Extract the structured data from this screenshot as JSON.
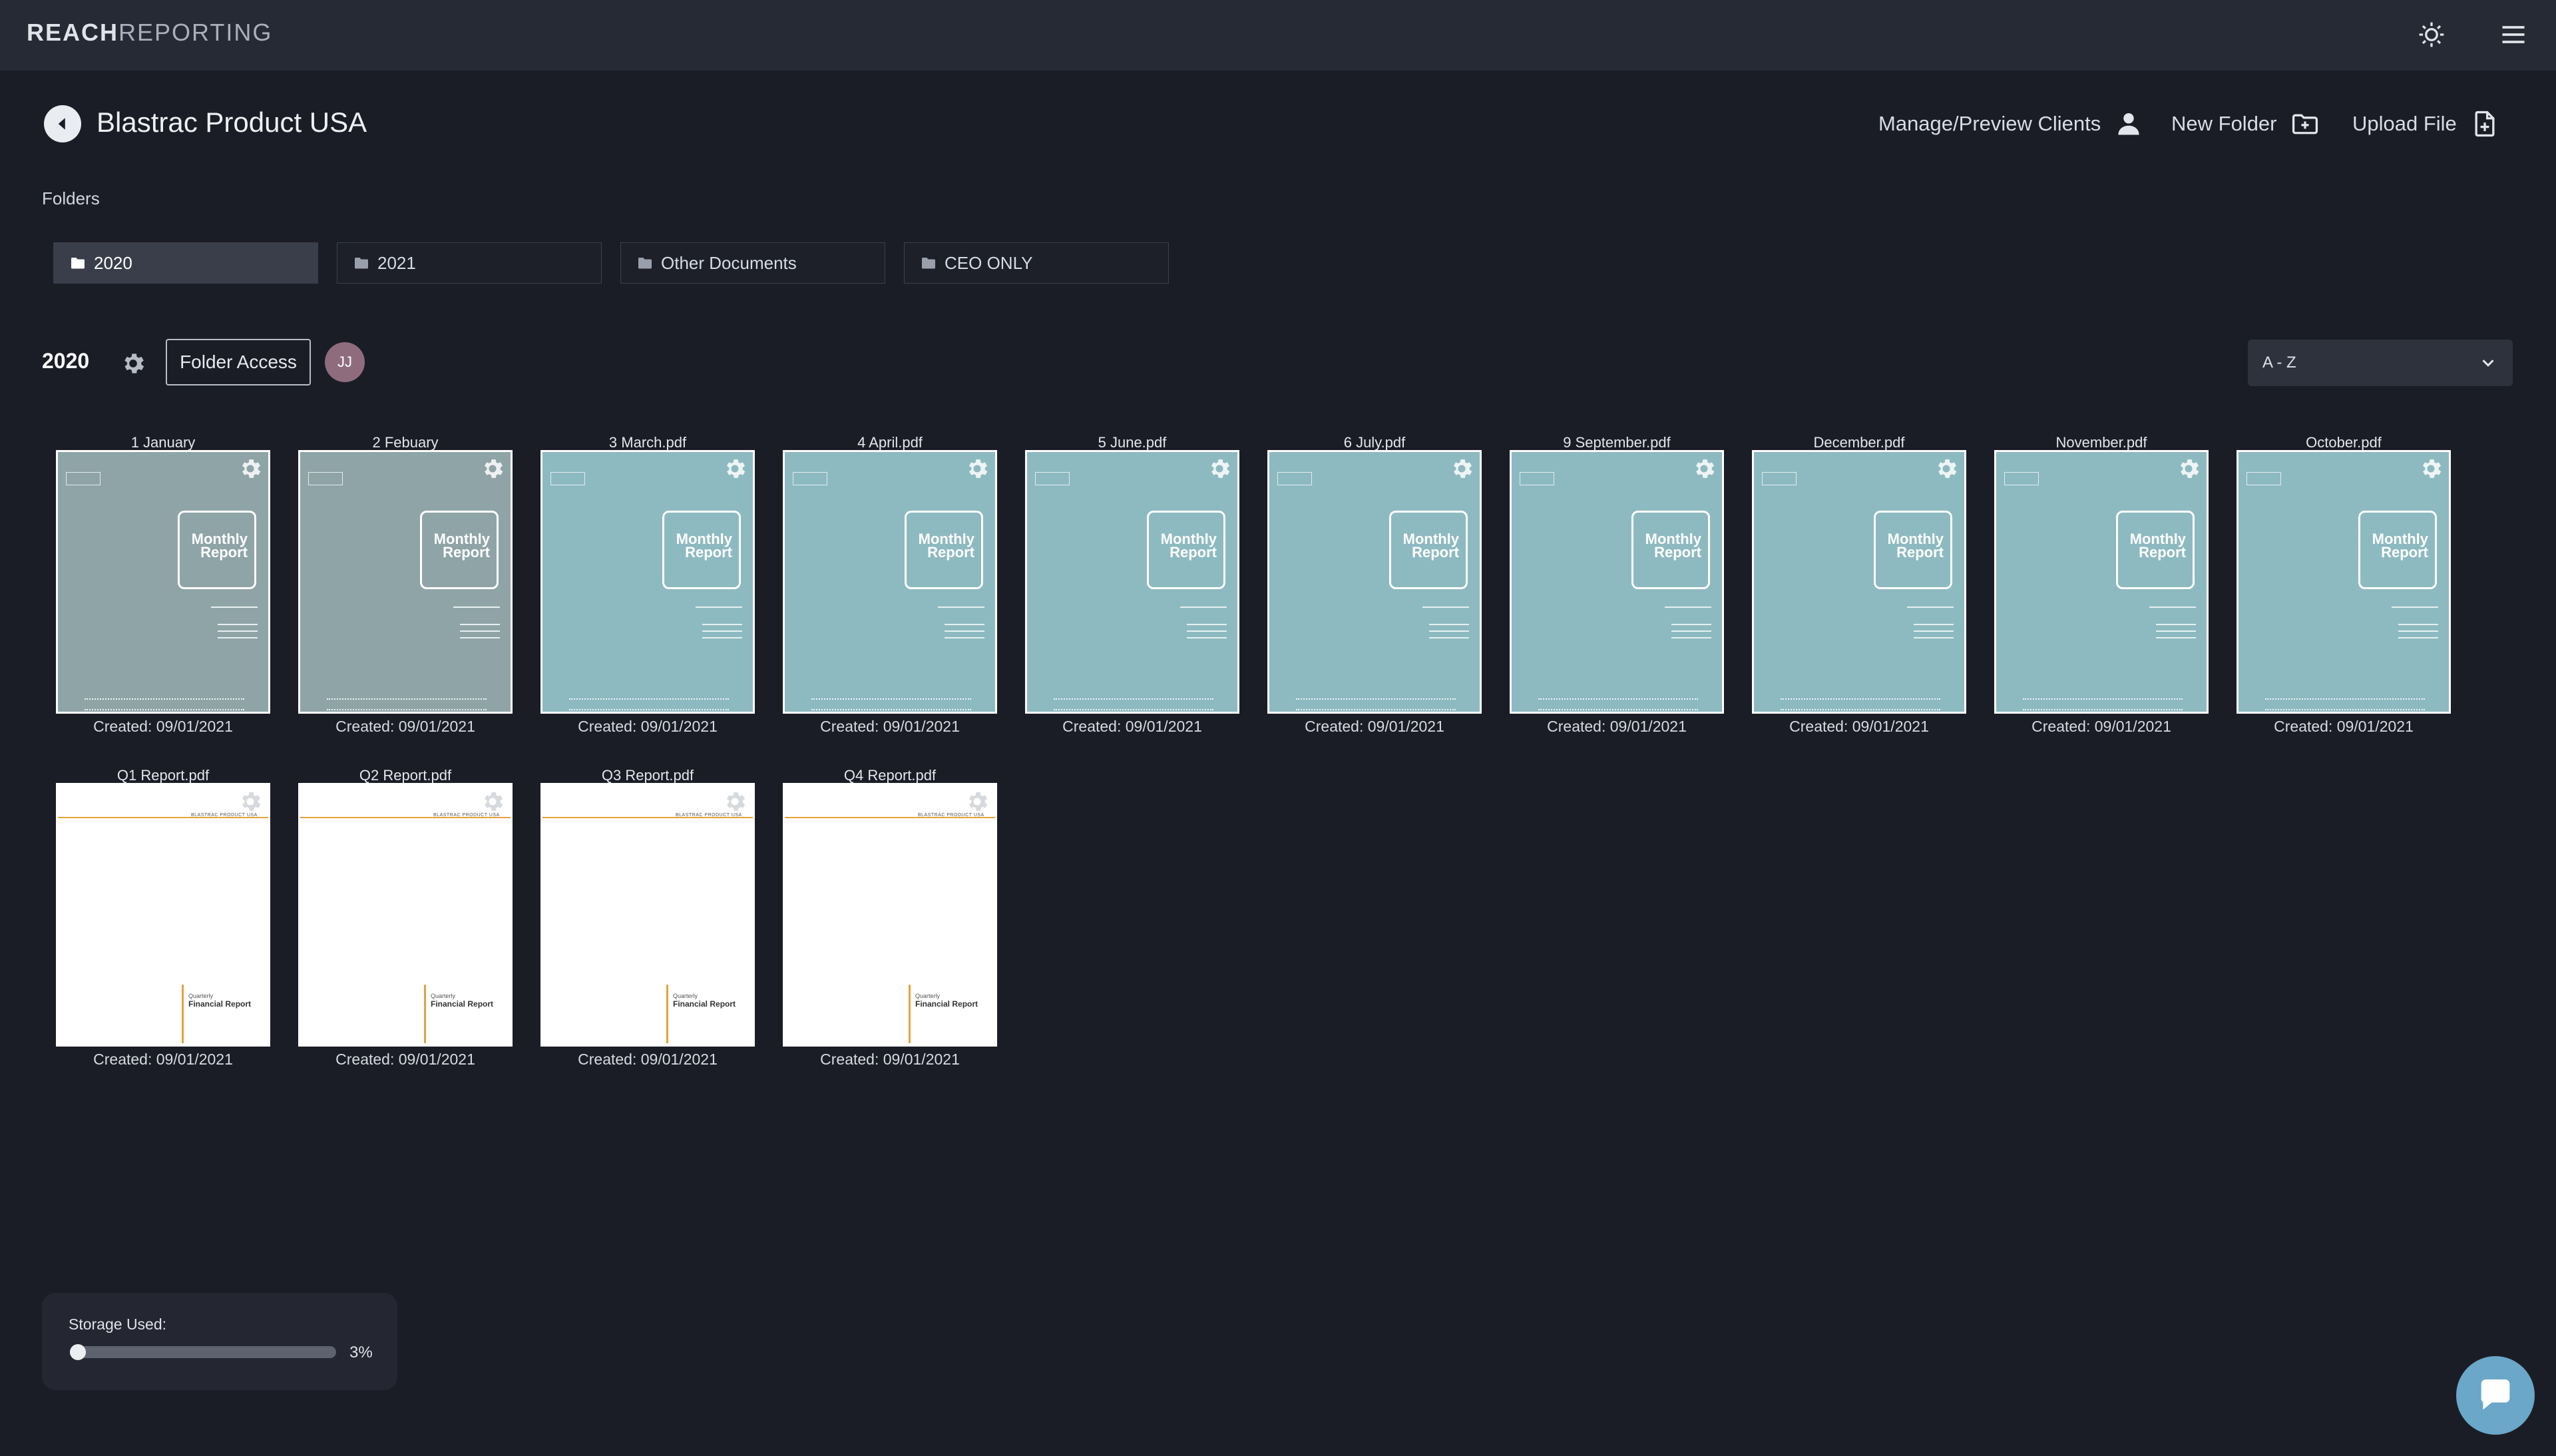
{
  "app": {
    "brand_bold": "REACH",
    "brand_light": "REPORTING"
  },
  "header": {
    "title": "Blastrac Product USA",
    "actions": [
      "Manage/Preview Clients",
      "New Folder",
      "Upload File"
    ]
  },
  "folders_label": "Folders",
  "folders": [
    "2020",
    "2021",
    "Other Documents",
    "CEO ONLY"
  ],
  "active_folder": {
    "name": "2020",
    "access_label": "Folder Access",
    "avatar_initials": "JJ"
  },
  "sort": {
    "value": "A - Z"
  },
  "files": [
    {
      "name": "1 January",
      "created": "Created: 09/01/2021",
      "kind": "monthly",
      "shade": "gray"
    },
    {
      "name": "2 Febuary",
      "created": "Created: 09/01/2021",
      "kind": "monthly",
      "shade": "gray"
    },
    {
      "name": "3 March.pdf",
      "created": "Created: 09/01/2021",
      "kind": "monthly",
      "shade": "teal"
    },
    {
      "name": "4 April.pdf",
      "created": "Created: 09/01/2021",
      "kind": "monthly",
      "shade": "teal"
    },
    {
      "name": "5 June.pdf",
      "created": "Created: 09/01/2021",
      "kind": "monthly",
      "shade": "teal"
    },
    {
      "name": "6 July.pdf",
      "created": "Created: 09/01/2021",
      "kind": "monthly",
      "shade": "teal"
    },
    {
      "name": "9 September.pdf",
      "created": "Created: 09/01/2021",
      "kind": "monthly",
      "shade": "teal"
    },
    {
      "name": "December.pdf",
      "created": "Created: 09/01/2021",
      "kind": "monthly",
      "shade": "teal"
    },
    {
      "name": "November.pdf",
      "created": "Created: 09/01/2021",
      "kind": "monthly",
      "shade": "teal"
    },
    {
      "name": "October.pdf",
      "created": "Created: 09/01/2021",
      "kind": "monthly",
      "shade": "teal"
    },
    {
      "name": "Q1 Report.pdf",
      "created": "Created: 09/01/2021",
      "kind": "quarterly"
    },
    {
      "name": "Q2 Report.pdf",
      "created": "Created: 09/01/2021",
      "kind": "quarterly"
    },
    {
      "name": "Q3 Report.pdf",
      "created": "Created: 09/01/2021",
      "kind": "quarterly"
    },
    {
      "name": "Q4 Report.pdf",
      "created": "Created: 09/01/2021",
      "kind": "quarterly"
    }
  ],
  "thumb_text": {
    "monthly_title_1": "Monthly",
    "monthly_title_2": "Report",
    "quarterly_header": "BLASTRAC PRODUCT USA",
    "quarterly_sub": "Quarterly",
    "quarterly_title": "Financial Report"
  },
  "storage": {
    "label": "Storage Used:",
    "percent": 3,
    "percent_label": "3%"
  },
  "colors": {
    "accent": "#6aa7c8",
    "background": "#1b1d26",
    "quarterly_line": "#e5a33b"
  },
  "icons": [
    "brightness-icon",
    "menu-icon",
    "back-icon",
    "user-icon",
    "new-folder-icon",
    "upload-file-icon",
    "folder-icon",
    "gear-icon",
    "chevron-down-icon",
    "chat-icon"
  ]
}
